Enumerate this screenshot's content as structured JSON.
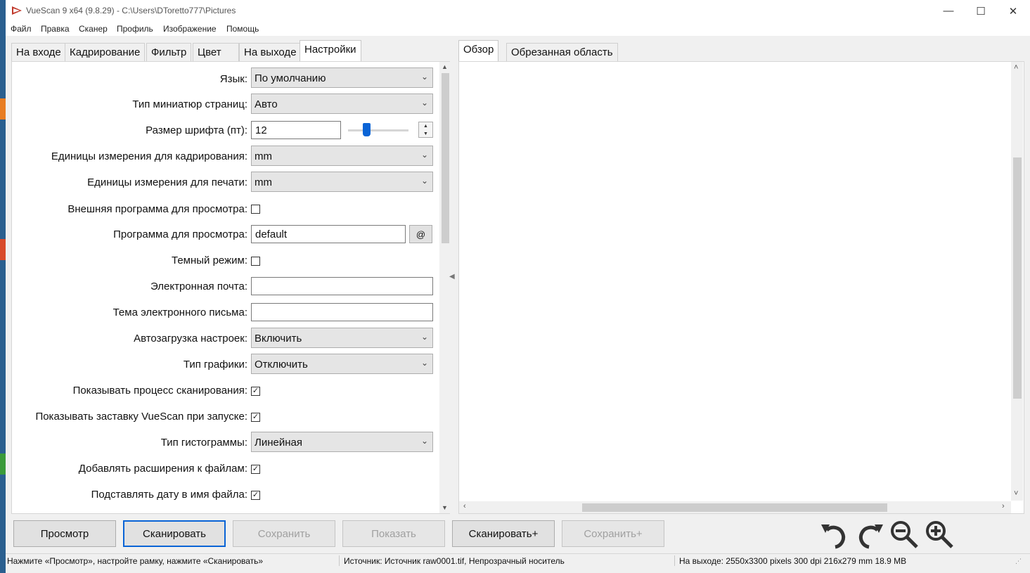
{
  "titlebar": {
    "title": "VueScan 9 x64 (9.8.29) - C:\\Users\\DToretto777\\Pictures",
    "minimize": "—",
    "maximize": "☐",
    "close": "✕"
  },
  "menu": [
    "Файл",
    "Правка",
    "Сканер",
    "Профиль",
    "Изображение",
    "Помощь"
  ],
  "left_tabs": [
    "На входе",
    "Кадрирование",
    "Фильтр",
    "Цвет",
    "На выходе",
    "Настройки"
  ],
  "active_left_tab": "Настройки",
  "settings": {
    "language": {
      "label": "Язык:",
      "value": "По умолчанию"
    },
    "thumb_type": {
      "label": "Тип миниатюр страниц:",
      "value": "Авто"
    },
    "font_size": {
      "label": "Размер шрифта (пт):",
      "value": "12",
      "slider_fraction": 0.28
    },
    "crop_units": {
      "label": "Единицы измерения для кадрирования:",
      "value": "mm"
    },
    "print_units": {
      "label": "Единицы измерения для печати:",
      "value": "mm"
    },
    "ext_viewer": {
      "label": "Внешняя программа для просмотра:",
      "checked": false
    },
    "viewer_program": {
      "label": "Программа для просмотра:",
      "value": "default",
      "button": "@"
    },
    "dark_mode": {
      "label": "Темный режим:",
      "checked": false
    },
    "email": {
      "label": "Электронная почта:",
      "value": ""
    },
    "email_subject": {
      "label": "Тема электронного письма:",
      "value": ""
    },
    "autoload": {
      "label": "Автозагрузка настроек:",
      "value": "Включить"
    },
    "graphics_type": {
      "label": "Тип графики:",
      "value": "Отключить"
    },
    "show_progress": {
      "label": "Показывать процесс сканирования:",
      "checked": true
    },
    "show_splash": {
      "label": "Показывать заставку VueScan при запуске:",
      "checked": true
    },
    "histogram_type": {
      "label": "Тип гистограммы:",
      "value": "Линейная"
    },
    "add_extensions": {
      "label": "Добавлять расширения к файлам:",
      "checked": true
    },
    "date_in_filename": {
      "label": "Подставлять дату в имя файла:",
      "checked": true
    }
  },
  "right_tabs": [
    "Обзор",
    "Обрезанная область"
  ],
  "active_right_tab": "Обзор",
  "buttons": {
    "preview": "Просмотр",
    "scan": "Сканировать",
    "save": "Сохранить",
    "show": "Показать",
    "scan_plus": "Сканировать+",
    "save_plus": "Сохранить+"
  },
  "status": {
    "hint": "Нажмите «Просмотр», настройте рамку, нажмите «Сканировать»",
    "source": "Источник: Источник raw0001.tif, Непрозрачный носитель",
    "output": "На выходе: 2550x3300 pixels 300 dpi 216x279 mm 18.9 MB"
  },
  "colors": {
    "accent": "#0a64d6",
    "window_bg": "#f0f0f0",
    "panel_bg": "#ffffff"
  }
}
